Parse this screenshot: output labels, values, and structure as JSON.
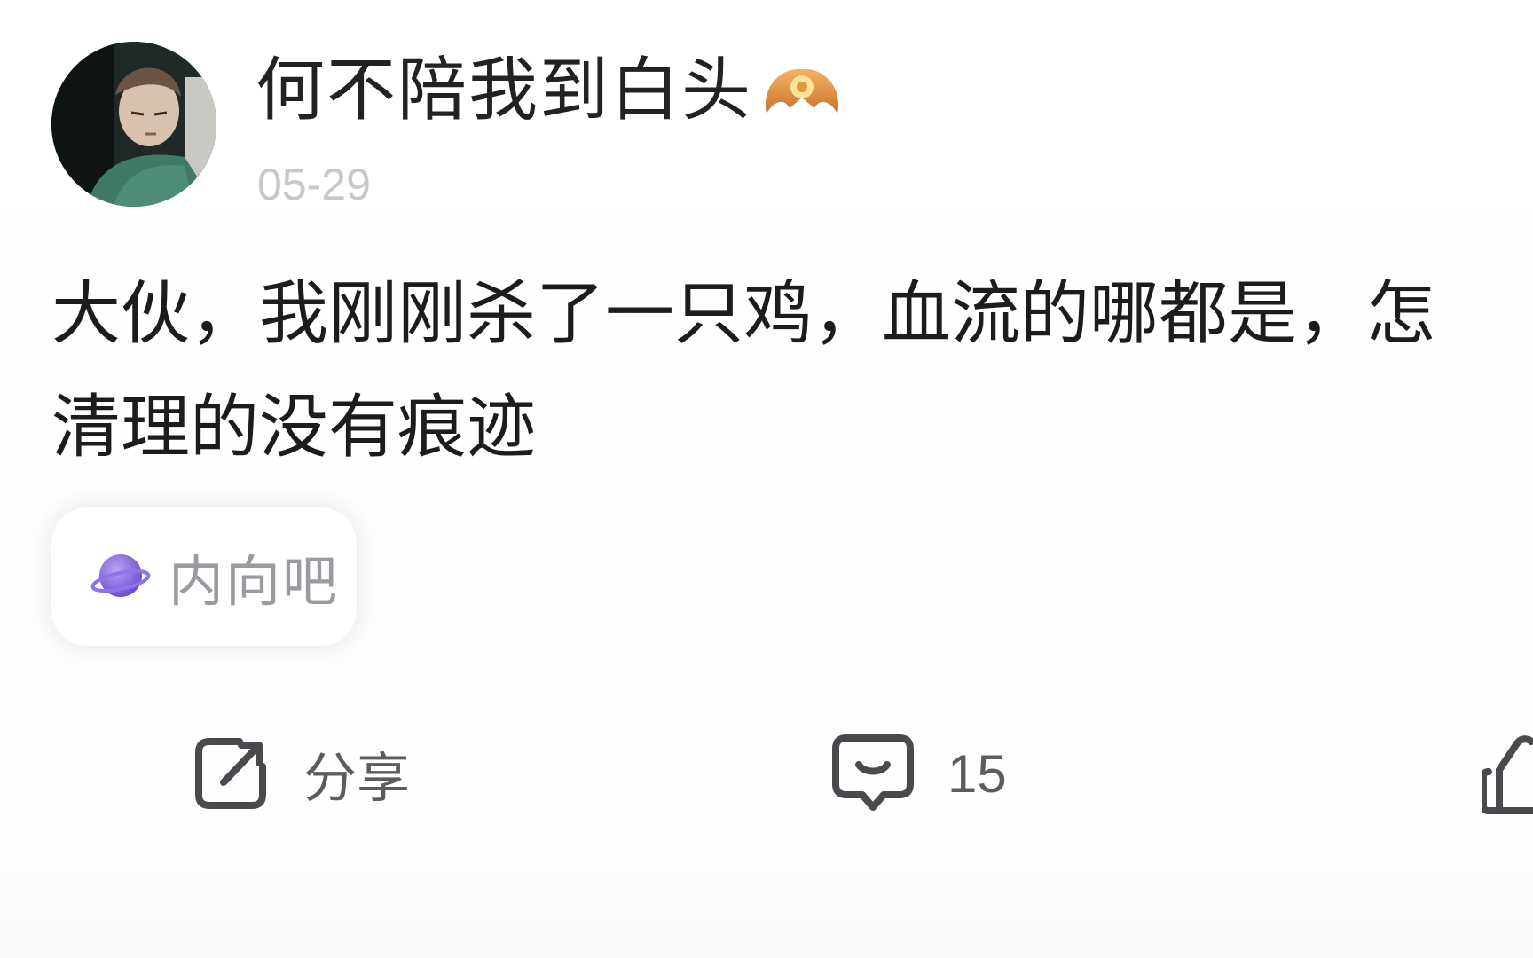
{
  "post": {
    "author": "何不陪我到白头",
    "date": "05-29",
    "body_lines": [
      "大伙，我刚刚杀了一只鸡，血流的哪都是，怎",
      "清理的没有痕迹"
    ],
    "topic": "内向吧"
  },
  "actions": {
    "share_label": "分享",
    "comment_count": "15"
  },
  "colors": {
    "text": "#1c1c1c",
    "meta": "#c8c8cc",
    "action": "#5c5c60",
    "topic_icon": "#7a5cd6"
  }
}
